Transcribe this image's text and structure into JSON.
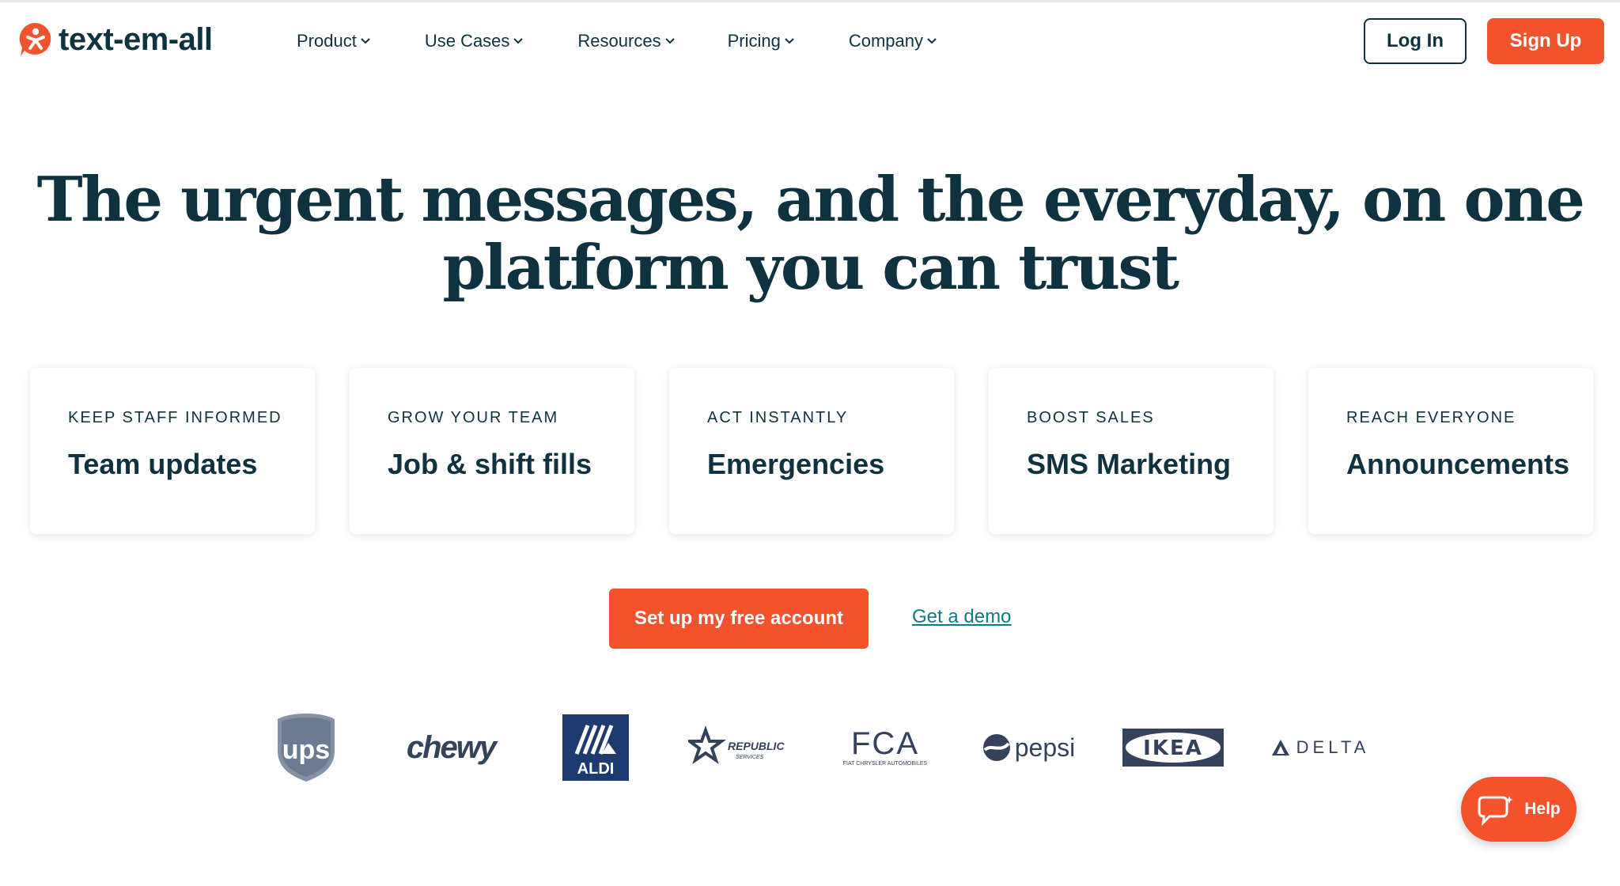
{
  "brand": {
    "name": "text-em-all",
    "accent_color": "#f4522d",
    "text_color": "#0e3240",
    "link_color": "#0d7c86"
  },
  "nav": {
    "items": [
      {
        "label": "Product",
        "icon": "chevron-down-icon"
      },
      {
        "label": "Use Cases",
        "icon": "chevron-down-icon"
      },
      {
        "label": "Resources",
        "icon": "chevron-down-icon"
      },
      {
        "label": "Pricing",
        "icon": "chevron-down-icon"
      },
      {
        "label": "Company",
        "icon": "chevron-down-icon"
      }
    ],
    "login_label": "Log In",
    "signup_label": "Sign Up"
  },
  "hero": {
    "title": "The urgent messages, and the everyday, on one platform you can trust"
  },
  "cards": [
    {
      "kicker": "KEEP STAFF INFORMED",
      "title": "Team updates"
    },
    {
      "kicker": "GROW YOUR TEAM",
      "title": "Job & shift fills"
    },
    {
      "kicker": "ACT INSTANTLY",
      "title": "Emergencies"
    },
    {
      "kicker": "BOOST SALES",
      "title": "SMS Marketing"
    },
    {
      "kicker": "REACH EVERYONE",
      "title": "Announcements"
    }
  ],
  "cta": {
    "primary_label": "Set up my free account",
    "secondary_label": "Get a demo"
  },
  "customer_logos": [
    {
      "name": "ups",
      "text": "ups"
    },
    {
      "name": "chewy",
      "text": "chewy"
    },
    {
      "name": "aldi",
      "text": "ALDI"
    },
    {
      "name": "republic-services",
      "text": "REPUBLIC",
      "subtext": "SERVICES"
    },
    {
      "name": "fca",
      "text": "FCA",
      "subtext": "FIAT CHRYSLER AUTOMOBILES"
    },
    {
      "name": "pepsi",
      "text": "pepsi"
    },
    {
      "name": "ikea",
      "text": "IKEA"
    },
    {
      "name": "delta",
      "text": "DELTA"
    }
  ],
  "help": {
    "label": "Help",
    "icon": "chat-bubbles-icon"
  }
}
